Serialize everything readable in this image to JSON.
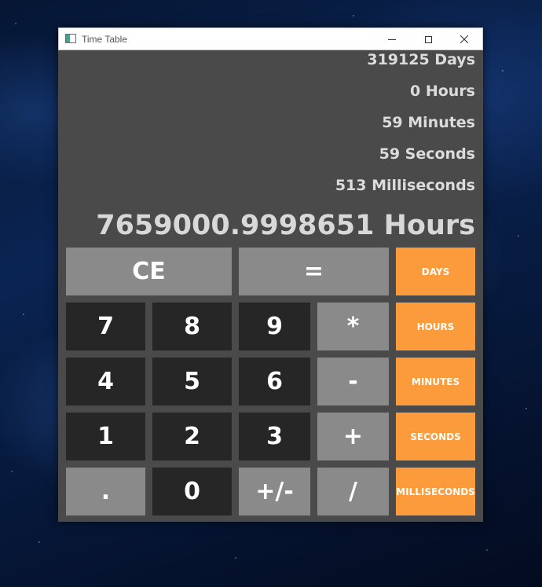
{
  "window": {
    "title": "Time Table",
    "controls": {
      "minimize": "minimize-icon",
      "maximize": "maximize-icon",
      "close": "close-icon"
    }
  },
  "display": {
    "days": "319125 Days",
    "hours": "0 Hours",
    "minutes": "59 Minutes",
    "seconds": "59 Seconds",
    "milliseconds": "513 Milliseconds",
    "total": "7659000.9998651 Hours"
  },
  "keys": {
    "ce": "CE",
    "equals": "=",
    "seven": "7",
    "eight": "8",
    "nine": "9",
    "multiply": "*",
    "four": "4",
    "five": "5",
    "six": "6",
    "minus": "-",
    "one": "1",
    "two": "2",
    "three": "3",
    "plus": "+",
    "dot": ".",
    "zero": "0",
    "negate": "+/-",
    "divide": "/"
  },
  "units": {
    "days": "DAYS",
    "hours": "HOURS",
    "minutes": "MINUTES",
    "seconds": "SECONDS",
    "milliseconds": "MILLISECONDS"
  },
  "colors": {
    "window_bg": "#4a4a4a",
    "digit_key": "#262626",
    "operator_key": "#8a8a8a",
    "unit_key": "#fb9b3b",
    "display_text": "#dcdcdc"
  }
}
